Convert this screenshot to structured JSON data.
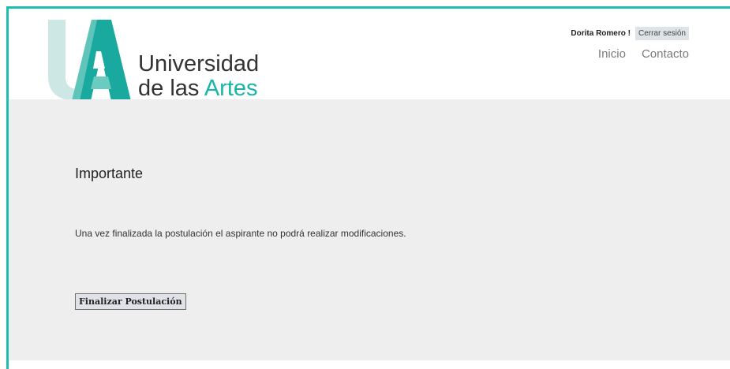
{
  "brand": {
    "line1": "Universidad",
    "line2_prefix": "de las ",
    "line2_accent": "Artes",
    "accent_color": "#18b5a8",
    "border_color": "#1fbcb0"
  },
  "user_bar": {
    "user_name": "Dorita Romero !",
    "logout_label": "Cerrar sesión"
  },
  "nav": {
    "items": [
      {
        "label": "Inicio"
      },
      {
        "label": "Contacto"
      }
    ]
  },
  "main": {
    "title": "Importante",
    "message": "Una vez finalizada la postulación el aspirante no podrá realizar modificaciones.",
    "finalize_label": "Finalizar Postulación"
  }
}
